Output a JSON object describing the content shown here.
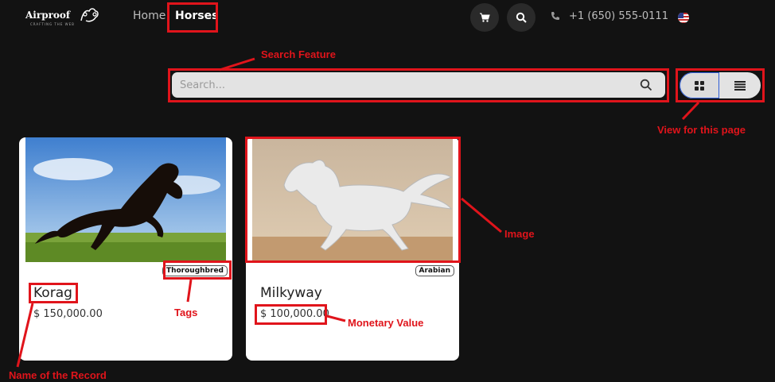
{
  "brand": {
    "name": "Airproof",
    "tagline": "CRAFTING THE WEB"
  },
  "nav": {
    "home": "Home",
    "horses": "Horses"
  },
  "header": {
    "phone": "+1 (650) 555-0111"
  },
  "search": {
    "placeholder": "Search..."
  },
  "cards": [
    {
      "name": "Korag",
      "price": "$ 150,000.00",
      "tag": "Thoroughbred"
    },
    {
      "name": "Milkyway",
      "price": "$ 100,000.00",
      "tag": "Arabian"
    }
  ],
  "annotations": {
    "search_feature": "Search Feature",
    "view": "View for this page",
    "image": "Image",
    "tags": "Tags",
    "monetary": "Monetary Value",
    "name_record": "Name of the Record"
  },
  "colors": {
    "background": "#121212",
    "annotation": "#e0141b",
    "card": "#ffffff",
    "toggle_active_border": "#2c5cd6"
  },
  "icons": [
    "cart-icon",
    "search-icon",
    "phone-icon",
    "us-flag-icon",
    "grid-view-icon",
    "list-view-icon"
  ]
}
